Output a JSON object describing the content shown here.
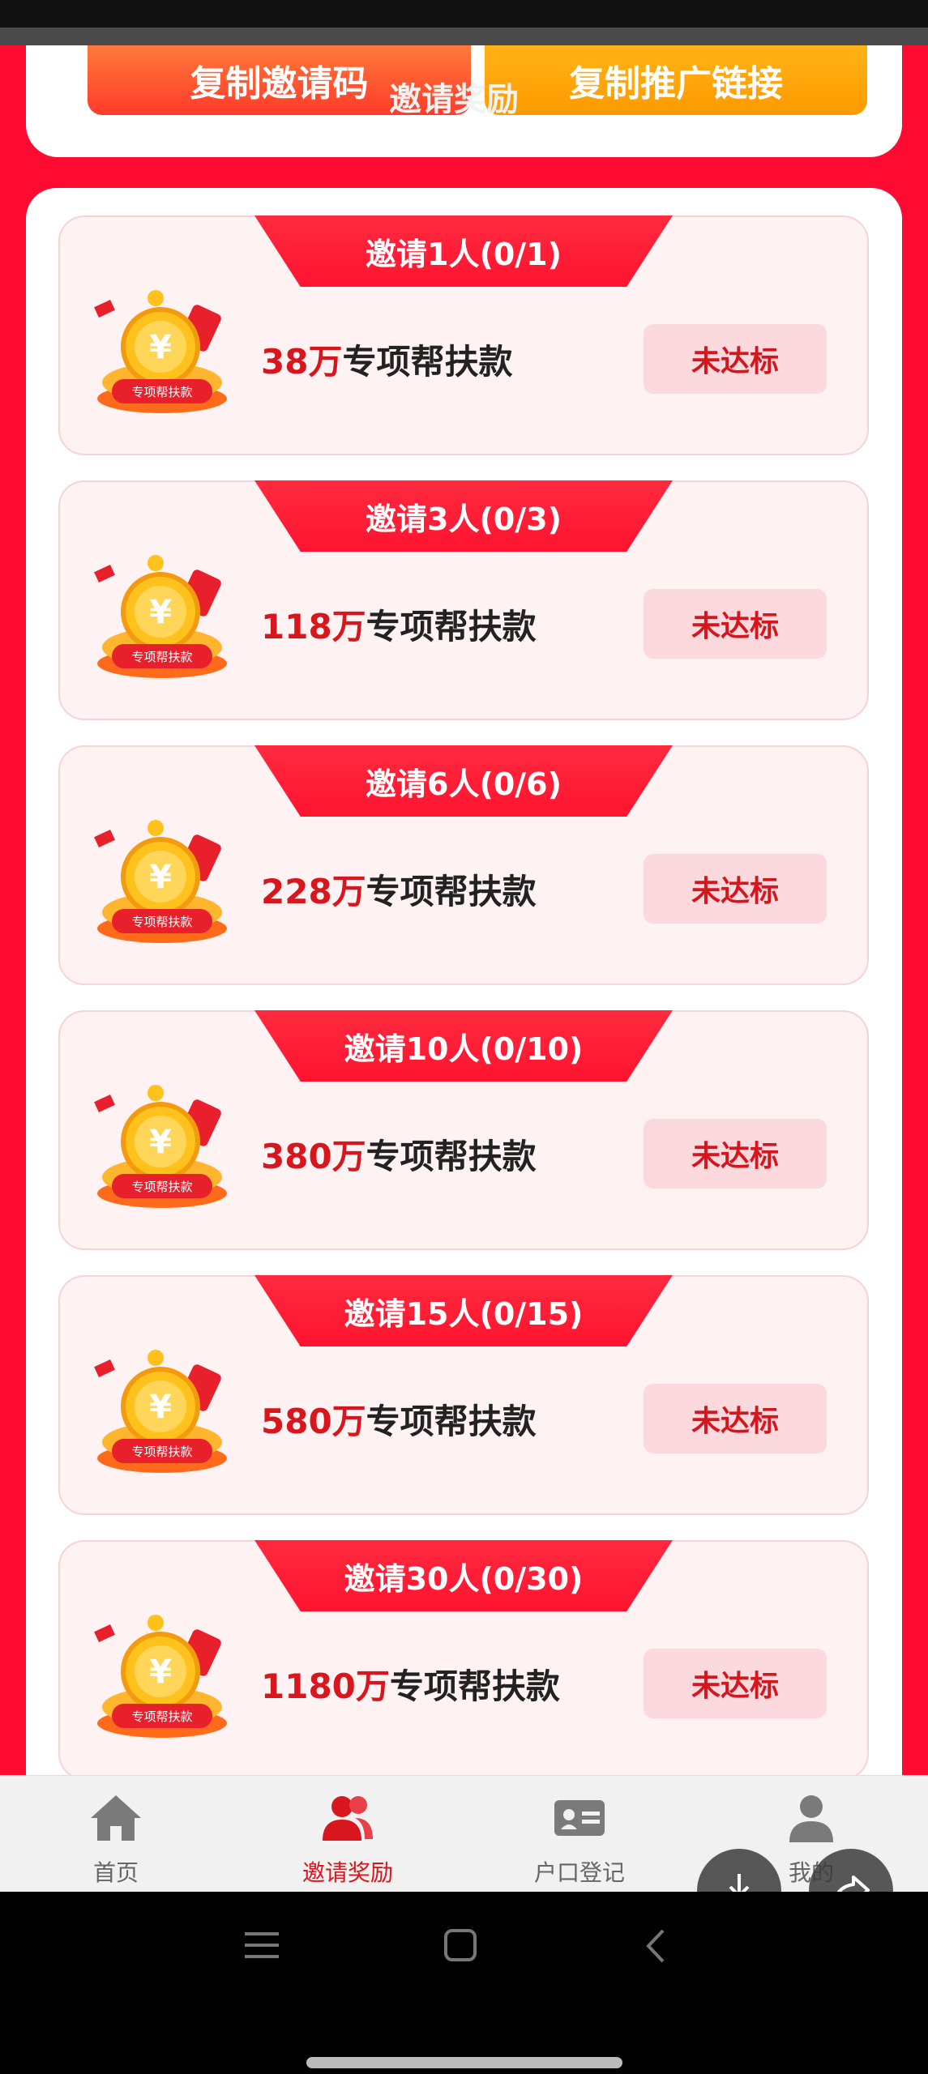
{
  "top": {
    "copy_code_label": "复制邀请码",
    "copy_link_label": "复制推广链接",
    "overlay_title": "邀请奖励"
  },
  "cards": [
    {
      "tab": "邀请1人(0/1)",
      "amount": "38万",
      "desc": "专项帮扶款",
      "status": "未达标",
      "icon_label": "专项帮扶款"
    },
    {
      "tab": "邀请3人(0/3)",
      "amount": "118万",
      "desc": "专项帮扶款",
      "status": "未达标",
      "icon_label": "专项帮扶款"
    },
    {
      "tab": "邀请6人(0/6)",
      "amount": "228万",
      "desc": "专项帮扶款",
      "status": "未达标",
      "icon_label": "专项帮扶款"
    },
    {
      "tab": "邀请10人(0/10)",
      "amount": "380万",
      "desc": "专项帮扶款",
      "status": "未达标",
      "icon_label": "专项帮扶款"
    },
    {
      "tab": "邀请15人(0/15)",
      "amount": "580万",
      "desc": "专项帮扶款",
      "status": "未达标",
      "icon_label": "专项帮扶款"
    },
    {
      "tab": "邀请30人(0/30)",
      "amount": "1180万",
      "desc": "专项帮扶款",
      "status": "未达标",
      "icon_label": "专项帮扶款"
    }
  ],
  "tabbar": {
    "items": [
      {
        "label": "首页",
        "icon": "home-icon",
        "active": false
      },
      {
        "label": "邀请奖励",
        "icon": "users-icon",
        "active": true
      },
      {
        "label": "户口登记",
        "icon": "id-card-icon",
        "active": false
      },
      {
        "label": "我的",
        "icon": "person-icon",
        "active": false
      }
    ]
  },
  "colors": {
    "background_red": "#ff0b32",
    "amount_red": "#d7161e",
    "copy_code_orange": "#ff4a2e",
    "copy_link_yellow": "#ffa40a"
  }
}
